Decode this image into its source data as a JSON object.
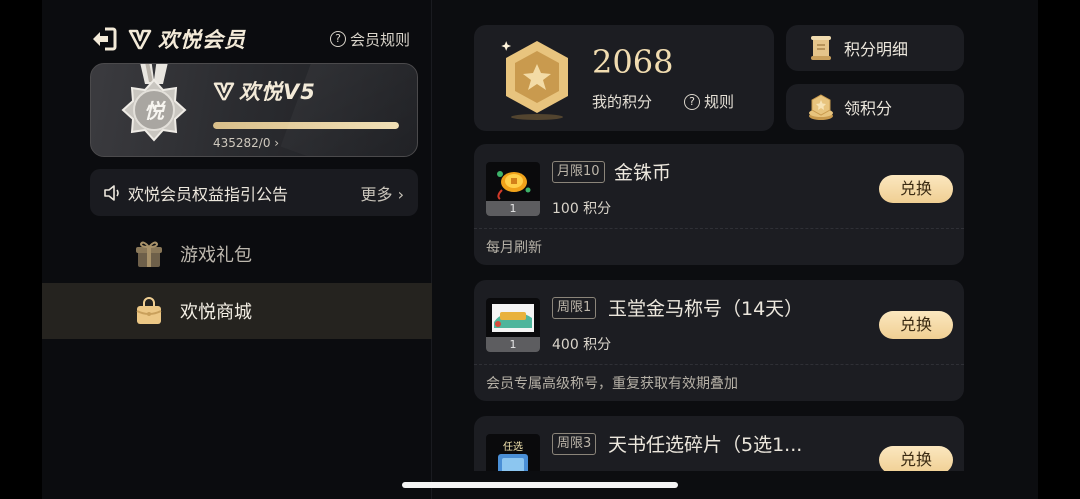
{
  "header": {
    "title": "欢悦会员",
    "rules_label": "会员规则"
  },
  "vip": {
    "level": "欢悦V5",
    "exp_text": "435282/0 ›",
    "progress": 1.0,
    "medal_glyph": "悦"
  },
  "notice": {
    "text": "欢悦会员权益指引公告",
    "more": "更多 ›"
  },
  "nav": [
    {
      "label": "游戏礼包",
      "icon": "gift-icon",
      "active": false
    },
    {
      "label": "欢悦商城",
      "icon": "shop-bag-icon",
      "active": true
    }
  ],
  "points": {
    "value": "2068",
    "label": "我的积分",
    "rule_label": "规则"
  },
  "side_buttons": [
    {
      "label": "积分明细",
      "icon": "scroll-icon"
    },
    {
      "label": "领积分",
      "icon": "coin-stack-icon"
    }
  ],
  "items": [
    {
      "tag": "月限10",
      "name": "金铢币",
      "cost": "100 积分",
      "qty": "1",
      "desc": "每月刷新",
      "button": "兑换"
    },
    {
      "tag": "周限1",
      "name": "玉堂金马称号（14天）",
      "cost": "400 积分",
      "qty": "1",
      "desc": "会员专属高级称号，重复获取有效期叠加",
      "button": "兑换"
    },
    {
      "tag": "周限3",
      "name": "天书任选碎片（5选1...",
      "cost": "",
      "qty": "",
      "desc": "",
      "button": "兑换"
    }
  ],
  "colors": {
    "accent_gold": "#f1dcb0",
    "button_gold": "#f0cf93",
    "card_bg": "#1c1d22",
    "active_nav_bg": "#25231f"
  }
}
